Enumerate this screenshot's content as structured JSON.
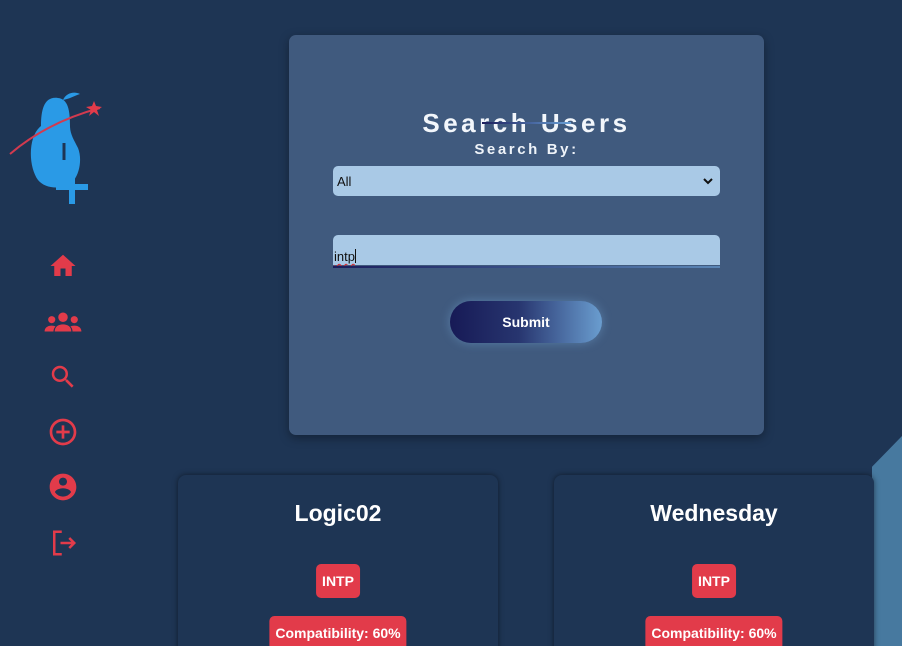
{
  "theme": {
    "background": "#1e3554",
    "panel": "#405a7e",
    "accent": "#e23b4a",
    "field": "#a9c9e6"
  },
  "sidebar": {
    "logo_icon": "pear-logo-icon",
    "nav": [
      {
        "id": "home",
        "icon": "home-icon"
      },
      {
        "id": "groups",
        "icon": "users-icon"
      },
      {
        "id": "search",
        "icon": "search-icon"
      },
      {
        "id": "add",
        "icon": "add-circle-icon"
      },
      {
        "id": "profile",
        "icon": "account-icon"
      },
      {
        "id": "logout",
        "icon": "logout-icon"
      }
    ]
  },
  "search_form": {
    "title": "Search Users",
    "search_by_label": "Search By:",
    "selected_option": "All",
    "query_value": "intp",
    "submit_label": "Submit"
  },
  "results": [
    {
      "username": "Logic02",
      "type": "INTP",
      "compatibility": "Compatibility: 60%"
    },
    {
      "username": "Wednesday",
      "type": "INTP",
      "compatibility": "Compatibility: 60%"
    }
  ]
}
